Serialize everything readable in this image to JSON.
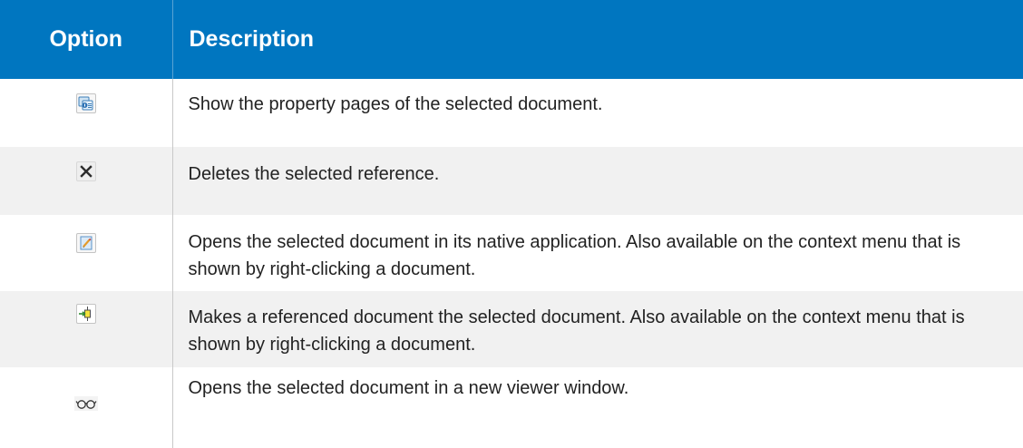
{
  "table": {
    "headers": {
      "option": "Option",
      "description": "Description"
    },
    "rows": [
      {
        "icon": "properties-icon",
        "description": "Show the property pages of the selected document."
      },
      {
        "icon": "delete-icon",
        "description": "Deletes the selected reference."
      },
      {
        "icon": "open-document-icon",
        "description": "Opens the selected document in its native application. Also available on the context menu that is shown by right-clicking a document."
      },
      {
        "icon": "make-selected-icon",
        "description": "Makes a referenced document the selected document. Also available on the context menu that is shown by right-clicking a document."
      },
      {
        "icon": "viewer-glasses-icon",
        "description": "Opens the selected document in a new viewer window."
      }
    ]
  },
  "colors": {
    "header_background": "#0076c0",
    "header_text": "#ffffff",
    "row_alt_background": "#f1f1f1",
    "body_text": "#222222"
  }
}
